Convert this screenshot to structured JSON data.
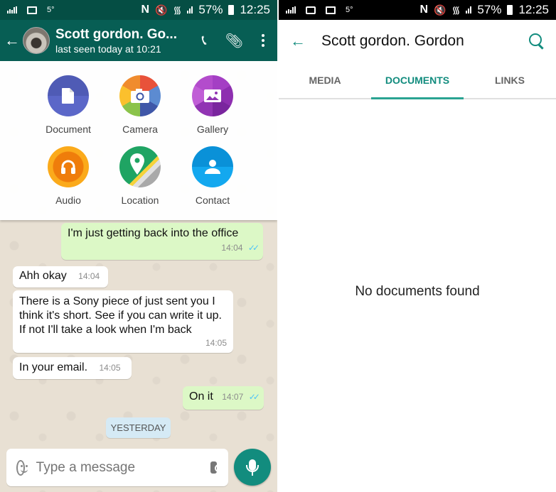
{
  "left": {
    "status_bar": {
      "temperature": "5°",
      "battery": "57%",
      "time": "12:25"
    },
    "header": {
      "title": "Scott gordon. Go...",
      "subtitle": "last seen today at 10:21"
    },
    "attach_menu": [
      {
        "label": "Document",
        "icon": "document-icon"
      },
      {
        "label": "Camera",
        "icon": "camera-icon"
      },
      {
        "label": "Gallery",
        "icon": "gallery-icon"
      },
      {
        "label": "Audio",
        "icon": "headphones-icon"
      },
      {
        "label": "Location",
        "icon": "location-pin-icon"
      },
      {
        "label": "Contact",
        "icon": "person-icon"
      }
    ],
    "messages": [
      {
        "direction": "out",
        "text": "I'm just getting back into the office",
        "time": "14:04",
        "ticks": "✓✓"
      },
      {
        "direction": "in",
        "text": "Ahh okay",
        "time": "14:04"
      },
      {
        "direction": "in",
        "text": "There is a Sony piece of just sent you I think it's short. See if you can write it up. If not I'll take a look when I'm back",
        "time": "14:05"
      },
      {
        "direction": "in",
        "text": "In your email.",
        "time": "14:05"
      },
      {
        "direction": "out",
        "text": "On it",
        "time": "14:07",
        "ticks": "✓✓"
      }
    ],
    "date_divider": "YESTERDAY",
    "input": {
      "placeholder": "Type a message"
    },
    "colors": {
      "header": "#075e54",
      "status_bar": "#054e44",
      "outgoing_bubble": "#dcf8c6",
      "accent": "#128c7e"
    }
  },
  "right": {
    "status_bar": {
      "temperature": "5°",
      "battery": "57%",
      "time": "12:25"
    },
    "header": {
      "title": "Scott gordon. Gordon"
    },
    "tabs": [
      {
        "label": "MEDIA",
        "active": false
      },
      {
        "label": "DOCUMENTS",
        "active": true
      },
      {
        "label": "LINKS",
        "active": false
      }
    ],
    "empty_message": "No documents found"
  }
}
